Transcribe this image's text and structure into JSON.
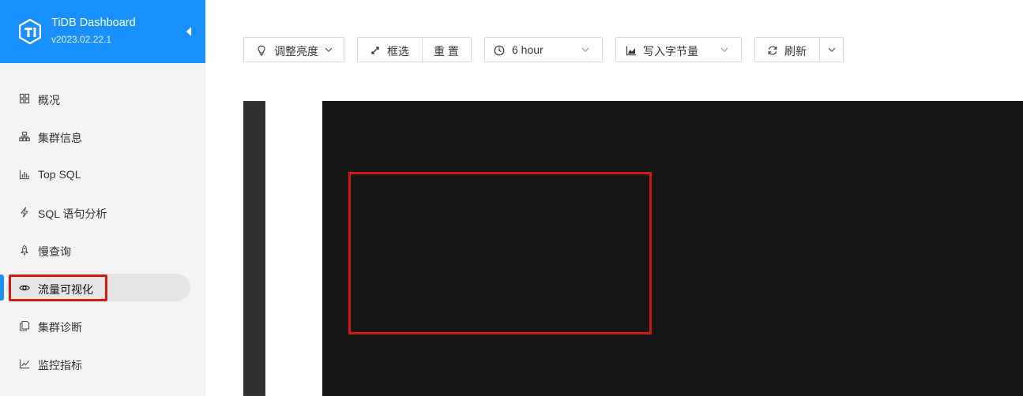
{
  "brand": {
    "title": "TiDB Dashboard",
    "version": "v2023.02.22.1"
  },
  "sidebar": {
    "items": [
      {
        "label": "概况",
        "icon": "grid-icon"
      },
      {
        "label": "集群信息",
        "icon": "cluster-icon"
      },
      {
        "label": "Top SQL",
        "icon": "bar-chart-icon"
      },
      {
        "label": "SQL 语句分析",
        "icon": "lightning-icon"
      },
      {
        "label": "慢查询",
        "icon": "rocket-icon"
      },
      {
        "label": "流量可视化",
        "icon": "eye-icon",
        "active": true
      },
      {
        "label": "集群诊断",
        "icon": "copy-icon"
      },
      {
        "label": "监控指标",
        "icon": "line-chart-icon"
      }
    ]
  },
  "toolbar": {
    "brightness_label": "调整亮度",
    "box_select_label": "框选",
    "reset_label": "重 置",
    "time_range": "6 hour",
    "metric": "写入字节量",
    "refresh_label": "刷新"
  },
  "colors": {
    "brand": "#1890ff",
    "highlight": "#d4170f",
    "heatmap_bg": "#161616"
  }
}
